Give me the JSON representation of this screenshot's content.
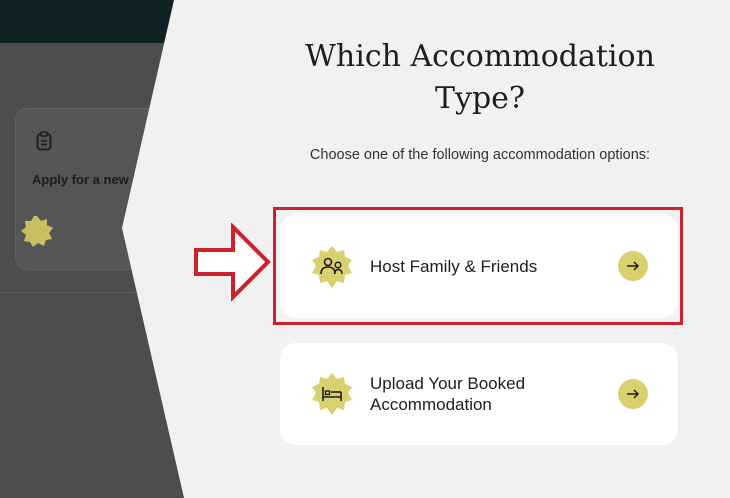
{
  "background": {
    "card_title": "Apply for a new Hayya",
    "colors": {
      "topbar": "#102224",
      "overlay": "#4d4d4d"
    }
  },
  "panel": {
    "title": "Which Accommodation Type?",
    "subtitle": "Choose one of the following accommodation options:"
  },
  "options": [
    {
      "label": "Host Family & Friends",
      "icon": "people-icon",
      "arrow": "arrow-right-icon"
    },
    {
      "label": "Upload Your Booked Accommodation",
      "icon": "bed-icon",
      "arrow": "arrow-right-icon"
    }
  ],
  "colors": {
    "accent": "#d9d06f",
    "highlight": "#d0202c",
    "text": "#1e1e1e",
    "card": "#ffffff",
    "panel": "#f1f1f1"
  }
}
